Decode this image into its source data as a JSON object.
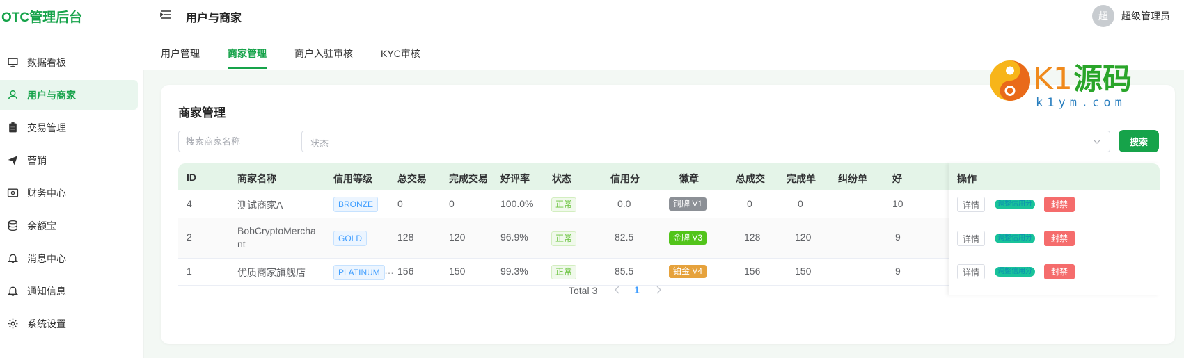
{
  "app": {
    "brand": "OTC管理后台"
  },
  "sidebar": {
    "items": [
      {
        "label": "数据看板",
        "icon": "presentation-board-icon"
      },
      {
        "label": "用户与商家",
        "icon": "user-icon",
        "active": true
      },
      {
        "label": "交易管理",
        "icon": "clipboard-icon"
      },
      {
        "label": "营销",
        "icon": "send-icon"
      },
      {
        "label": "财务中心",
        "icon": "money-card-icon"
      },
      {
        "label": "余额宝",
        "icon": "database-icon"
      },
      {
        "label": "消息中心",
        "icon": "bell-icon"
      },
      {
        "label": "通知信息",
        "icon": "bell-icon"
      },
      {
        "label": "系统设置",
        "icon": "gear-icon"
      }
    ]
  },
  "header": {
    "breadcrumb": "用户与商家",
    "avatar_text": "超",
    "user_name": "超级管理员"
  },
  "tabs": [
    {
      "label": "用户管理"
    },
    {
      "label": "商家管理",
      "active": true
    },
    {
      "label": "商户入驻审核"
    },
    {
      "label": "KYC审核"
    }
  ],
  "watermark": {
    "text": "K1源码",
    "url": "k1ym.com"
  },
  "card": {
    "title": "商家管理",
    "search_placeholder": "搜索商家名称",
    "status_placeholder": "状态",
    "search_button": "搜索"
  },
  "table": {
    "headers": {
      "id": "ID",
      "name": "商家名称",
      "level": "信用等级",
      "total_trades": "总交易",
      "done_trades": "完成交易",
      "rating": "好评率",
      "status": "状态",
      "credit": "信用分",
      "badge": "徽章",
      "total_deals": "总成交",
      "done_orders": "完成单",
      "dispute": "纠纷单",
      "good": "好",
      "ops": "操作"
    },
    "rows": [
      {
        "id": "4",
        "name": "测试商家A",
        "level": "BRONZE",
        "total_trades": "0",
        "done_trades": "0",
        "rating": "100.0%",
        "status": "正常",
        "credit": "0.0",
        "badge": "铜牌 V1",
        "badge_color": "#8c9096",
        "total_deals": "0",
        "done_orders": "0",
        "good": "10"
      },
      {
        "id": "2",
        "name": "BobCryptoMerchant",
        "level": "GOLD",
        "total_trades": "128",
        "done_trades": "120",
        "rating": "96.9%",
        "status": "正常",
        "credit": "82.5",
        "badge": "金牌 V3",
        "badge_color": "#52c41a",
        "total_deals": "128",
        "done_orders": "120",
        "good": "9"
      },
      {
        "id": "1",
        "name": "优质商家旗舰店",
        "level": "PLATINUM",
        "total_trades": "156",
        "done_trades": "150",
        "rating": "99.3%",
        "status": "正常",
        "credit": "85.5",
        "badge": "铂金 V4",
        "badge_color": "#e6a23c",
        "total_deals": "156",
        "done_orders": "150",
        "good": "9"
      }
    ],
    "actions": {
      "detail": "详情",
      "adjust": "调整信用分",
      "ban": "封禁"
    }
  },
  "pagination": {
    "total": "Total 3",
    "current_page": "1"
  },
  "colors": {
    "brand": "#16a34a",
    "link": "#409eff",
    "danger": "#f56c6c"
  }
}
